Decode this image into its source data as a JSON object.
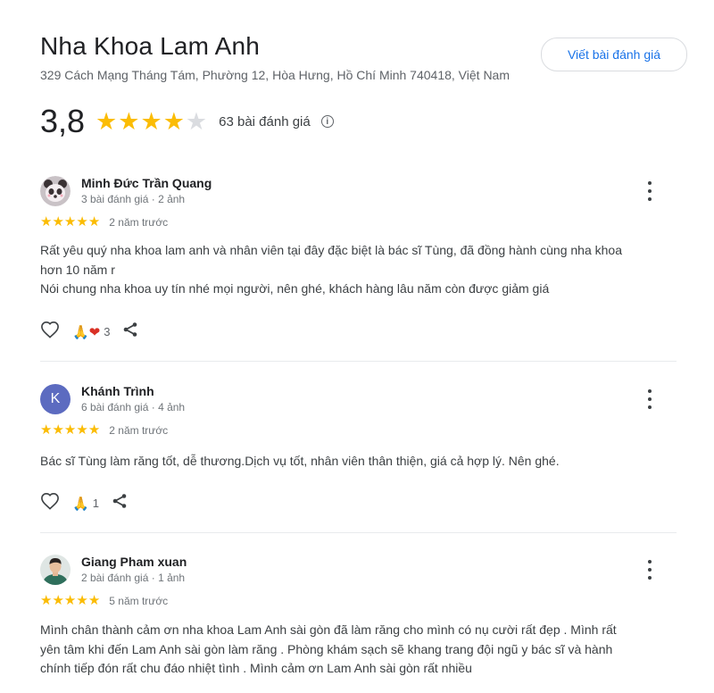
{
  "place": {
    "name": "Nha Khoa Lam Anh",
    "address": "329 Cách Mạng Tháng Tám, Phường 12, Hòa Hưng, Hồ Chí Minh 740418, Việt Nam",
    "write_review_label": "Viết bài đánh giá",
    "rating": "3,8",
    "rating_value": 3.8,
    "review_count": "63 bài đánh giá",
    "info_glyph": "i"
  },
  "reviews": [
    {
      "name": "Minh Đức Trần Quang",
      "meta": "3 bài đánh giá · 2 ảnh",
      "stars": 5,
      "time": "2 năm trước",
      "text": [
        "Rất yêu quý nha khoa lam anh và nhân viên tại đây đặc biệt là bác sĩ Tùng, đã đồng hành cùng nha khoa",
        "hơn 10 năm r",
        "Nói chung nha khoa uy tín nhé mọi người, nên ghé, khách hàng lâu năm còn được giảm giá"
      ],
      "reactions": "🙏❤",
      "reaction_count": "3",
      "avatar": "panda-avatar"
    },
    {
      "name": "Khánh Trình",
      "meta": "6 bài đánh giá · 4 ảnh",
      "stars": 5,
      "time": "2 năm trước",
      "text": [
        "Bác sĩ Tùng làm răng tốt, dễ thương.Dịch vụ tốt, nhân viên thân thiện, giá cả hợp lý. Nên ghé."
      ],
      "reactions": "🙏",
      "reaction_count": "1",
      "avatar_letter": "K"
    },
    {
      "name": "Giang Pham xuan",
      "meta": "2 bài đánh giá · 1 ảnh",
      "stars": 5,
      "time": "5 năm trước",
      "text": [
        "Mình chân thành cảm ơn nha khoa Lam Anh sài gòn đã làm răng cho mình có nụ cười rất đẹp . Mình rất",
        "yên tâm khi đến Lam Anh sài gòn làm răng . Phòng khám sạch sẽ khang trang đội ngũ y bác sĩ và hành",
        "chính tiếp đón rất chu đáo nhiệt tình . Mình cảm ơn Lam Anh sài gòn rất nhiều"
      ],
      "avatar": "person-avatar"
    }
  ],
  "colors": {
    "star": "#fbbc04",
    "link": "#1a73e8",
    "avatar_k": "#5c6bc0"
  }
}
